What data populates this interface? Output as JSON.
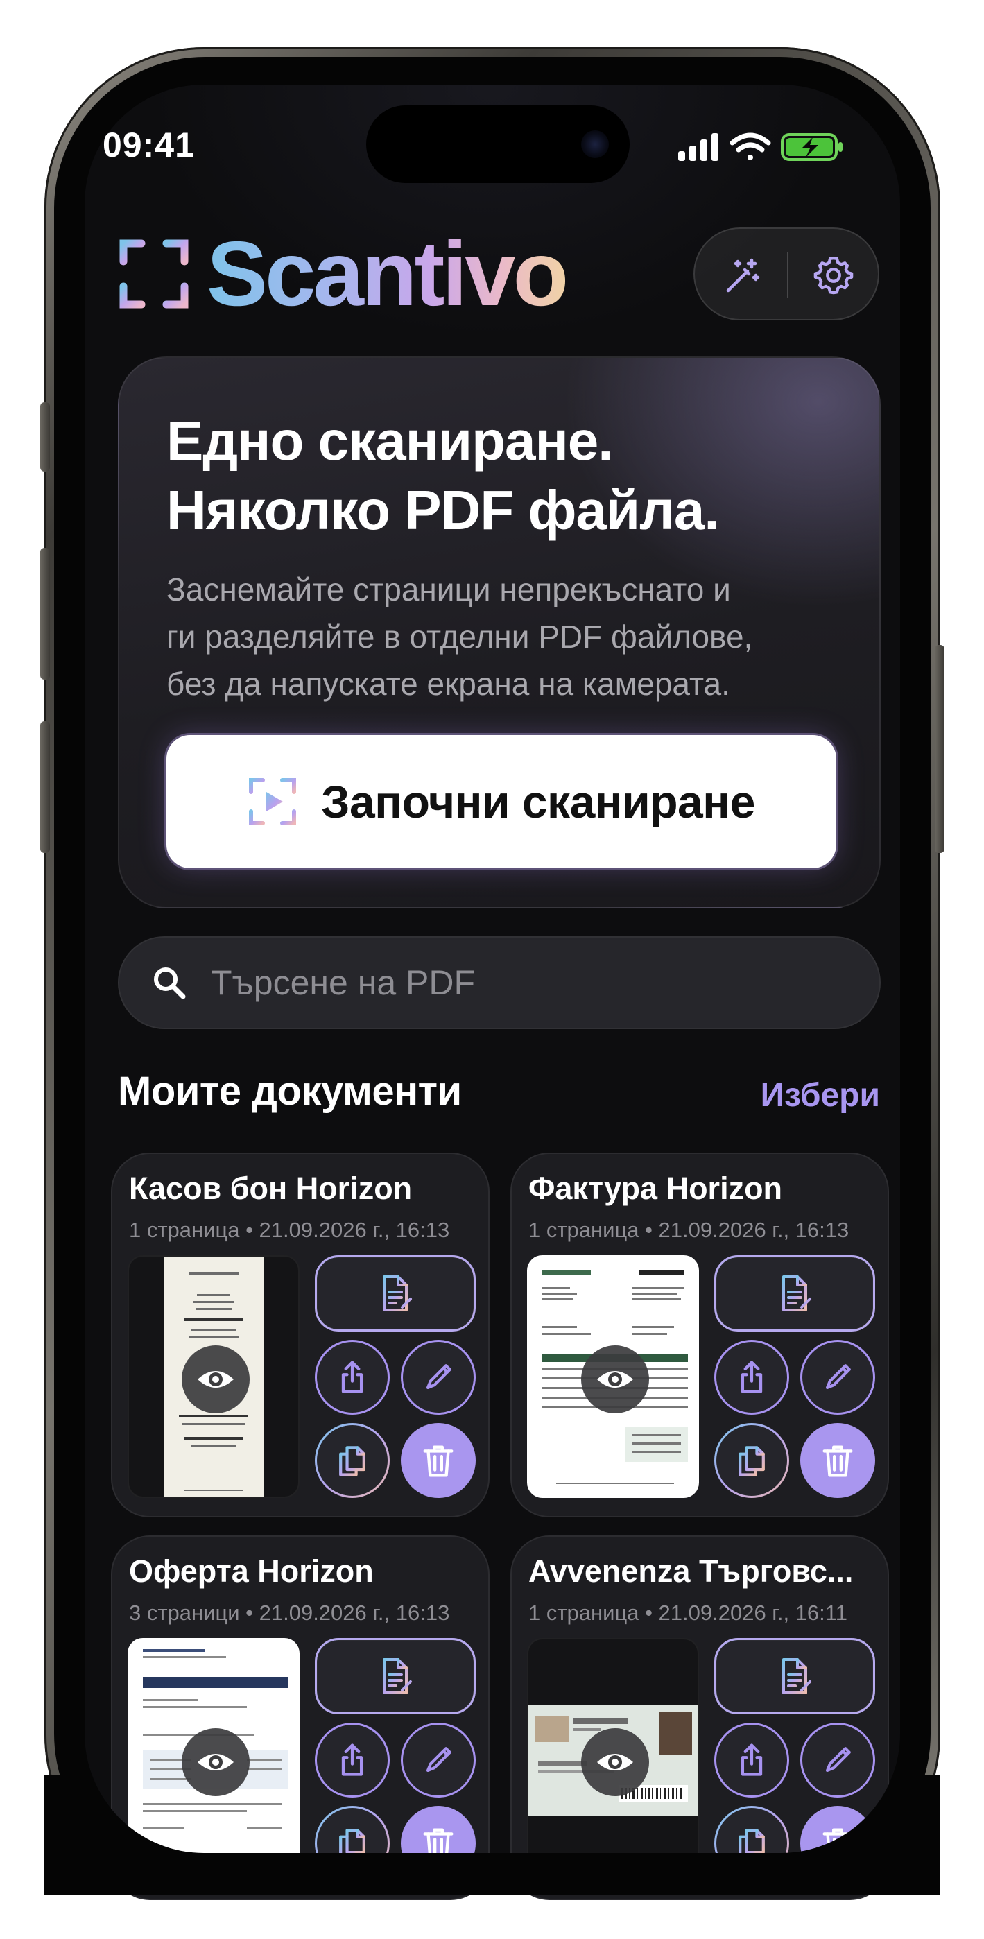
{
  "status_bar": {
    "time": "09:41"
  },
  "header": {
    "app_name": "Scantivo"
  },
  "hero": {
    "title_line1": "Едно сканиране.",
    "title_line2": "Няколко PDF файла.",
    "subtitle_line1": "Заснемайте страници непрекъснато и",
    "subtitle_line2": "ги разделяйте в отделни PDF файлове,",
    "subtitle_line3": "без да напускате екрана на камерата.",
    "button_label": "Започни сканиране"
  },
  "search": {
    "placeholder": "Търсене на PDF"
  },
  "documents": {
    "section_title": "Моите документи",
    "select_label": "Избери",
    "items": [
      {
        "title": "Касов бон Horizon",
        "meta": "1 страница • 21.09.2026 г., 16:13"
      },
      {
        "title": "Фактура Horizon",
        "meta": "1 страница • 21.09.2026 г., 16:13"
      },
      {
        "title": "Оферта Horizon",
        "meta": "3 страници • 21.09.2026 г., 16:13"
      },
      {
        "title": "Avvenenza Търговс...",
        "meta": "1 страница • 21.09.2026 г., 16:11"
      }
    ]
  },
  "colors": {
    "accent": "#a996ef",
    "background": "#0d0d0f",
    "card": "#1d1d21"
  },
  "icons": [
    "signal-icon",
    "wifi-icon",
    "battery-charging-icon",
    "magic-wand-icon",
    "gear-icon",
    "scan-frame-icon",
    "search-icon",
    "eye-icon",
    "document-text-icon",
    "share-icon",
    "pencil-icon",
    "copy-icon",
    "trash-icon"
  ]
}
